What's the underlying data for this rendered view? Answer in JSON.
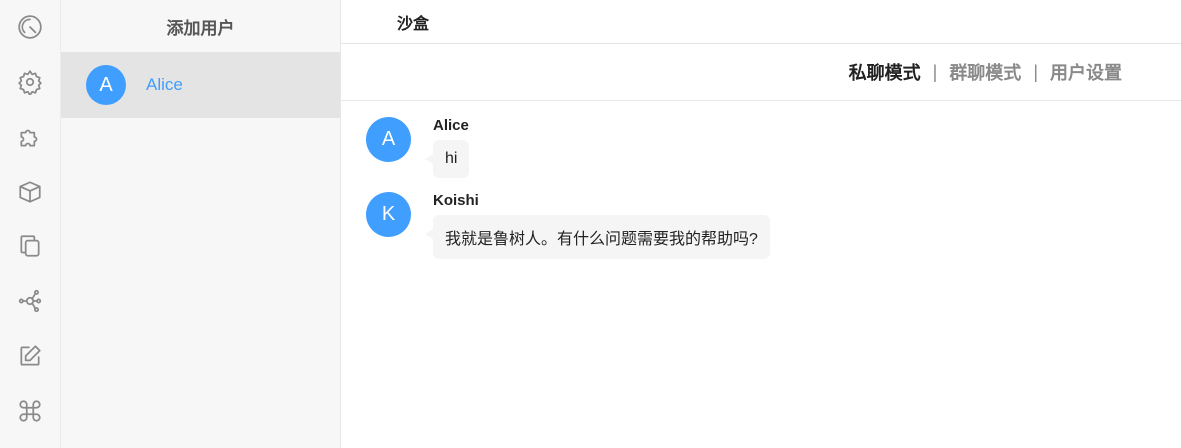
{
  "rail": {
    "icons": [
      "dashboard-gauge-icon",
      "gear-icon",
      "puzzle-icon",
      "box-icon",
      "copy-icon",
      "network-icon",
      "edit-icon",
      "command-icon"
    ]
  },
  "userpanel": {
    "add_user_label": "添加用户",
    "users": [
      {
        "initial": "A",
        "name": "Alice"
      }
    ]
  },
  "main": {
    "tab_label": "沙盒",
    "modes": [
      {
        "label": "私聊模式",
        "active": true
      },
      {
        "label": "群聊模式",
        "active": false
      },
      {
        "label": "用户设置",
        "active": false
      }
    ],
    "separator": "|",
    "messages": [
      {
        "initial": "A",
        "sender": "Alice",
        "text": "hi"
      },
      {
        "initial": "K",
        "sender": "Koishi",
        "text": "我就是鲁树人。有什么问题需要我的帮助吗?"
      }
    ]
  },
  "colors": {
    "accent": "#409eff",
    "text": "#222222",
    "muted": "#8a8a8a"
  }
}
